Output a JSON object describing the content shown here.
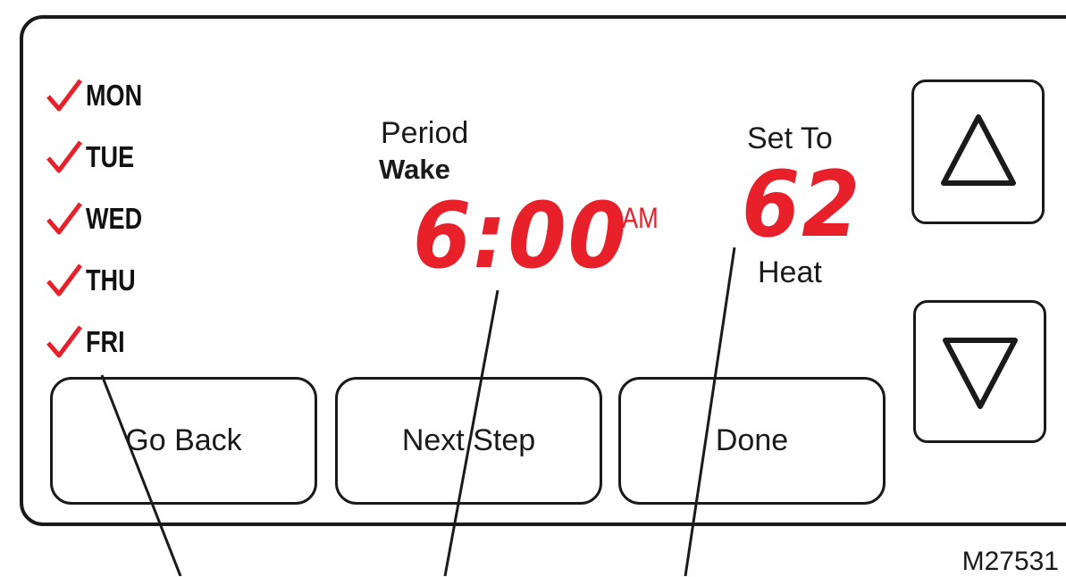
{
  "days": [
    "MON",
    "TUE",
    "WED",
    "THU",
    "FRI"
  ],
  "period": {
    "label": "Period",
    "value": "Wake"
  },
  "time": {
    "value": "6:00",
    "ampm": "AM"
  },
  "setpoint": {
    "label": "Set To",
    "value": "62",
    "mode": "Heat"
  },
  "buttons": {
    "go_back": "Go Back",
    "next_step": "Next Step",
    "done": "Done"
  },
  "figure_code": "M27531",
  "colors": {
    "lcd_red": "#e8202a",
    "check_red": "#e8202a",
    "outline": "#1a1a1a"
  },
  "icons": {
    "up": "triangle-up-icon",
    "down": "triangle-down-icon",
    "check": "checkmark-icon"
  }
}
